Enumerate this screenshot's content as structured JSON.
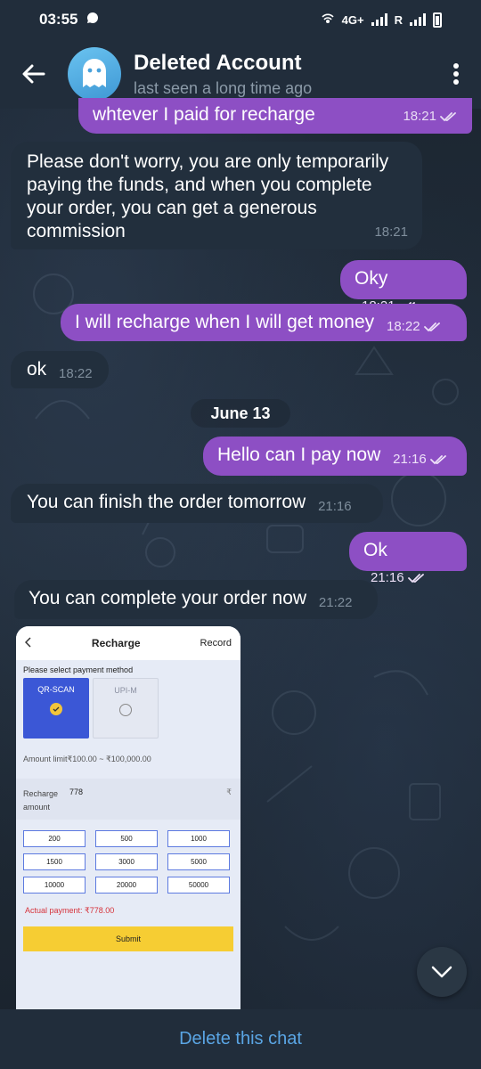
{
  "status_bar": {
    "time": "03:55",
    "network": "4G+",
    "roaming": "R"
  },
  "header": {
    "title": "Deleted Account",
    "subtitle": "last seen a long time ago"
  },
  "messages": [
    {
      "side": "out",
      "text": "whtever I paid for recharge",
      "time": "18:21",
      "read": true
    },
    {
      "side": "in",
      "text": "Please don't worry, you are only temporarily paying the funds, and when you complete your order, you can get a generous commission",
      "time": "18:21"
    },
    {
      "side": "out",
      "text": "Oky",
      "time": "18:21",
      "read": true
    },
    {
      "side": "out",
      "text": "I will recharge when I will get money",
      "time": "18:22",
      "read": true
    },
    {
      "side": "in",
      "text": "ok",
      "time": "18:22"
    },
    {
      "side": "out",
      "text": "Hello can I pay now",
      "time": "21:16",
      "read": true
    },
    {
      "side": "in",
      "text": "You can finish the order tomorrow",
      "time": "21:16"
    },
    {
      "side": "out",
      "text": "Ok",
      "time": "21:16",
      "read": true
    },
    {
      "side": "in",
      "text": "You can complete your order now",
      "time": "21:22"
    }
  ],
  "date_separator": "June 13",
  "image_message": {
    "title": "Recharge",
    "record_label": "Record",
    "section_label": "Please select payment method",
    "methods": [
      {
        "label": "QR-SCAN",
        "selected": true
      },
      {
        "label": "UPI-M",
        "selected": false
      }
    ],
    "amount_limit": "Amount limit₹100.00 ~ ₹100,000.00",
    "amount_label": "Recharge amount",
    "amount_value": "778",
    "currency": "₹",
    "presets": [
      "200",
      "500",
      "1000",
      "1500",
      "3000",
      "5000",
      "10000",
      "20000",
      "50000"
    ],
    "actual_payment": "Actual payment: ₹778.00",
    "submit_label": "Submit"
  },
  "footer": {
    "action": "Delete this chat"
  },
  "colors": {
    "outgoing_bubble": "#8d4fc4",
    "incoming_bubble": "#222f3d",
    "header_bg": "#212d3b",
    "link": "#5aa5e4"
  }
}
